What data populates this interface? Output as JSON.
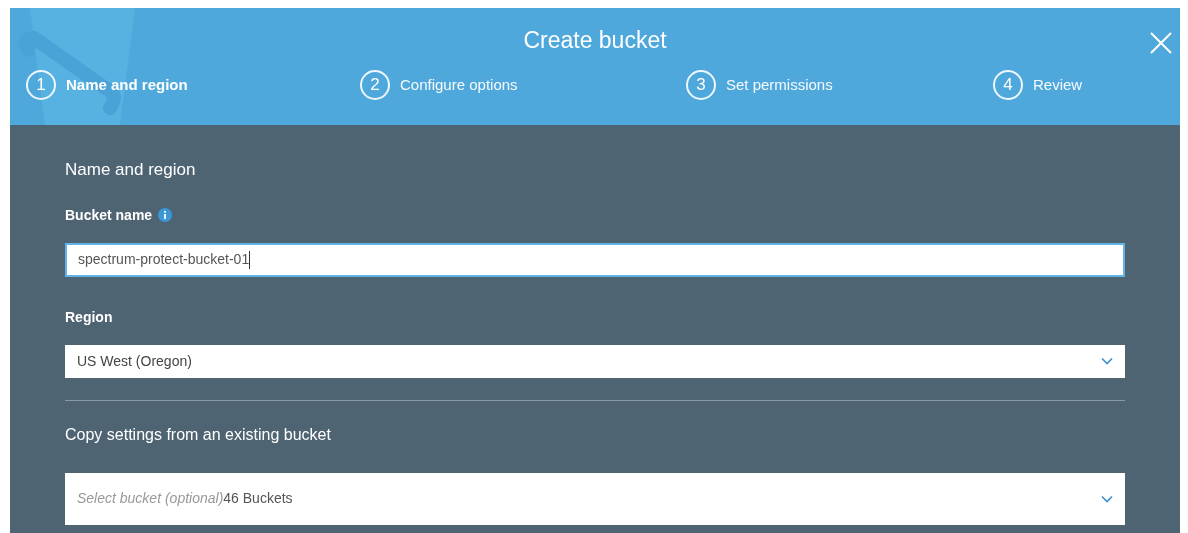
{
  "dialog": {
    "title": "Create bucket"
  },
  "steps": [
    {
      "number": "1",
      "label": "Name and region",
      "selected": true
    },
    {
      "number": "2",
      "label": "Configure options",
      "selected": false
    },
    {
      "number": "3",
      "label": "Set permissions",
      "selected": false
    },
    {
      "number": "4",
      "label": "Review",
      "selected": false
    }
  ],
  "section_title": "Name and region",
  "bucket_name": {
    "label": "Bucket name",
    "value": "spectrum-protect-bucket-01",
    "focused": true
  },
  "region": {
    "label": "Region",
    "value": "US West (Oregon)"
  },
  "copy_settings": {
    "title": "Copy settings from an existing bucket",
    "placeholder": "Select bucket (optional)",
    "count": "46 Buckets"
  }
}
